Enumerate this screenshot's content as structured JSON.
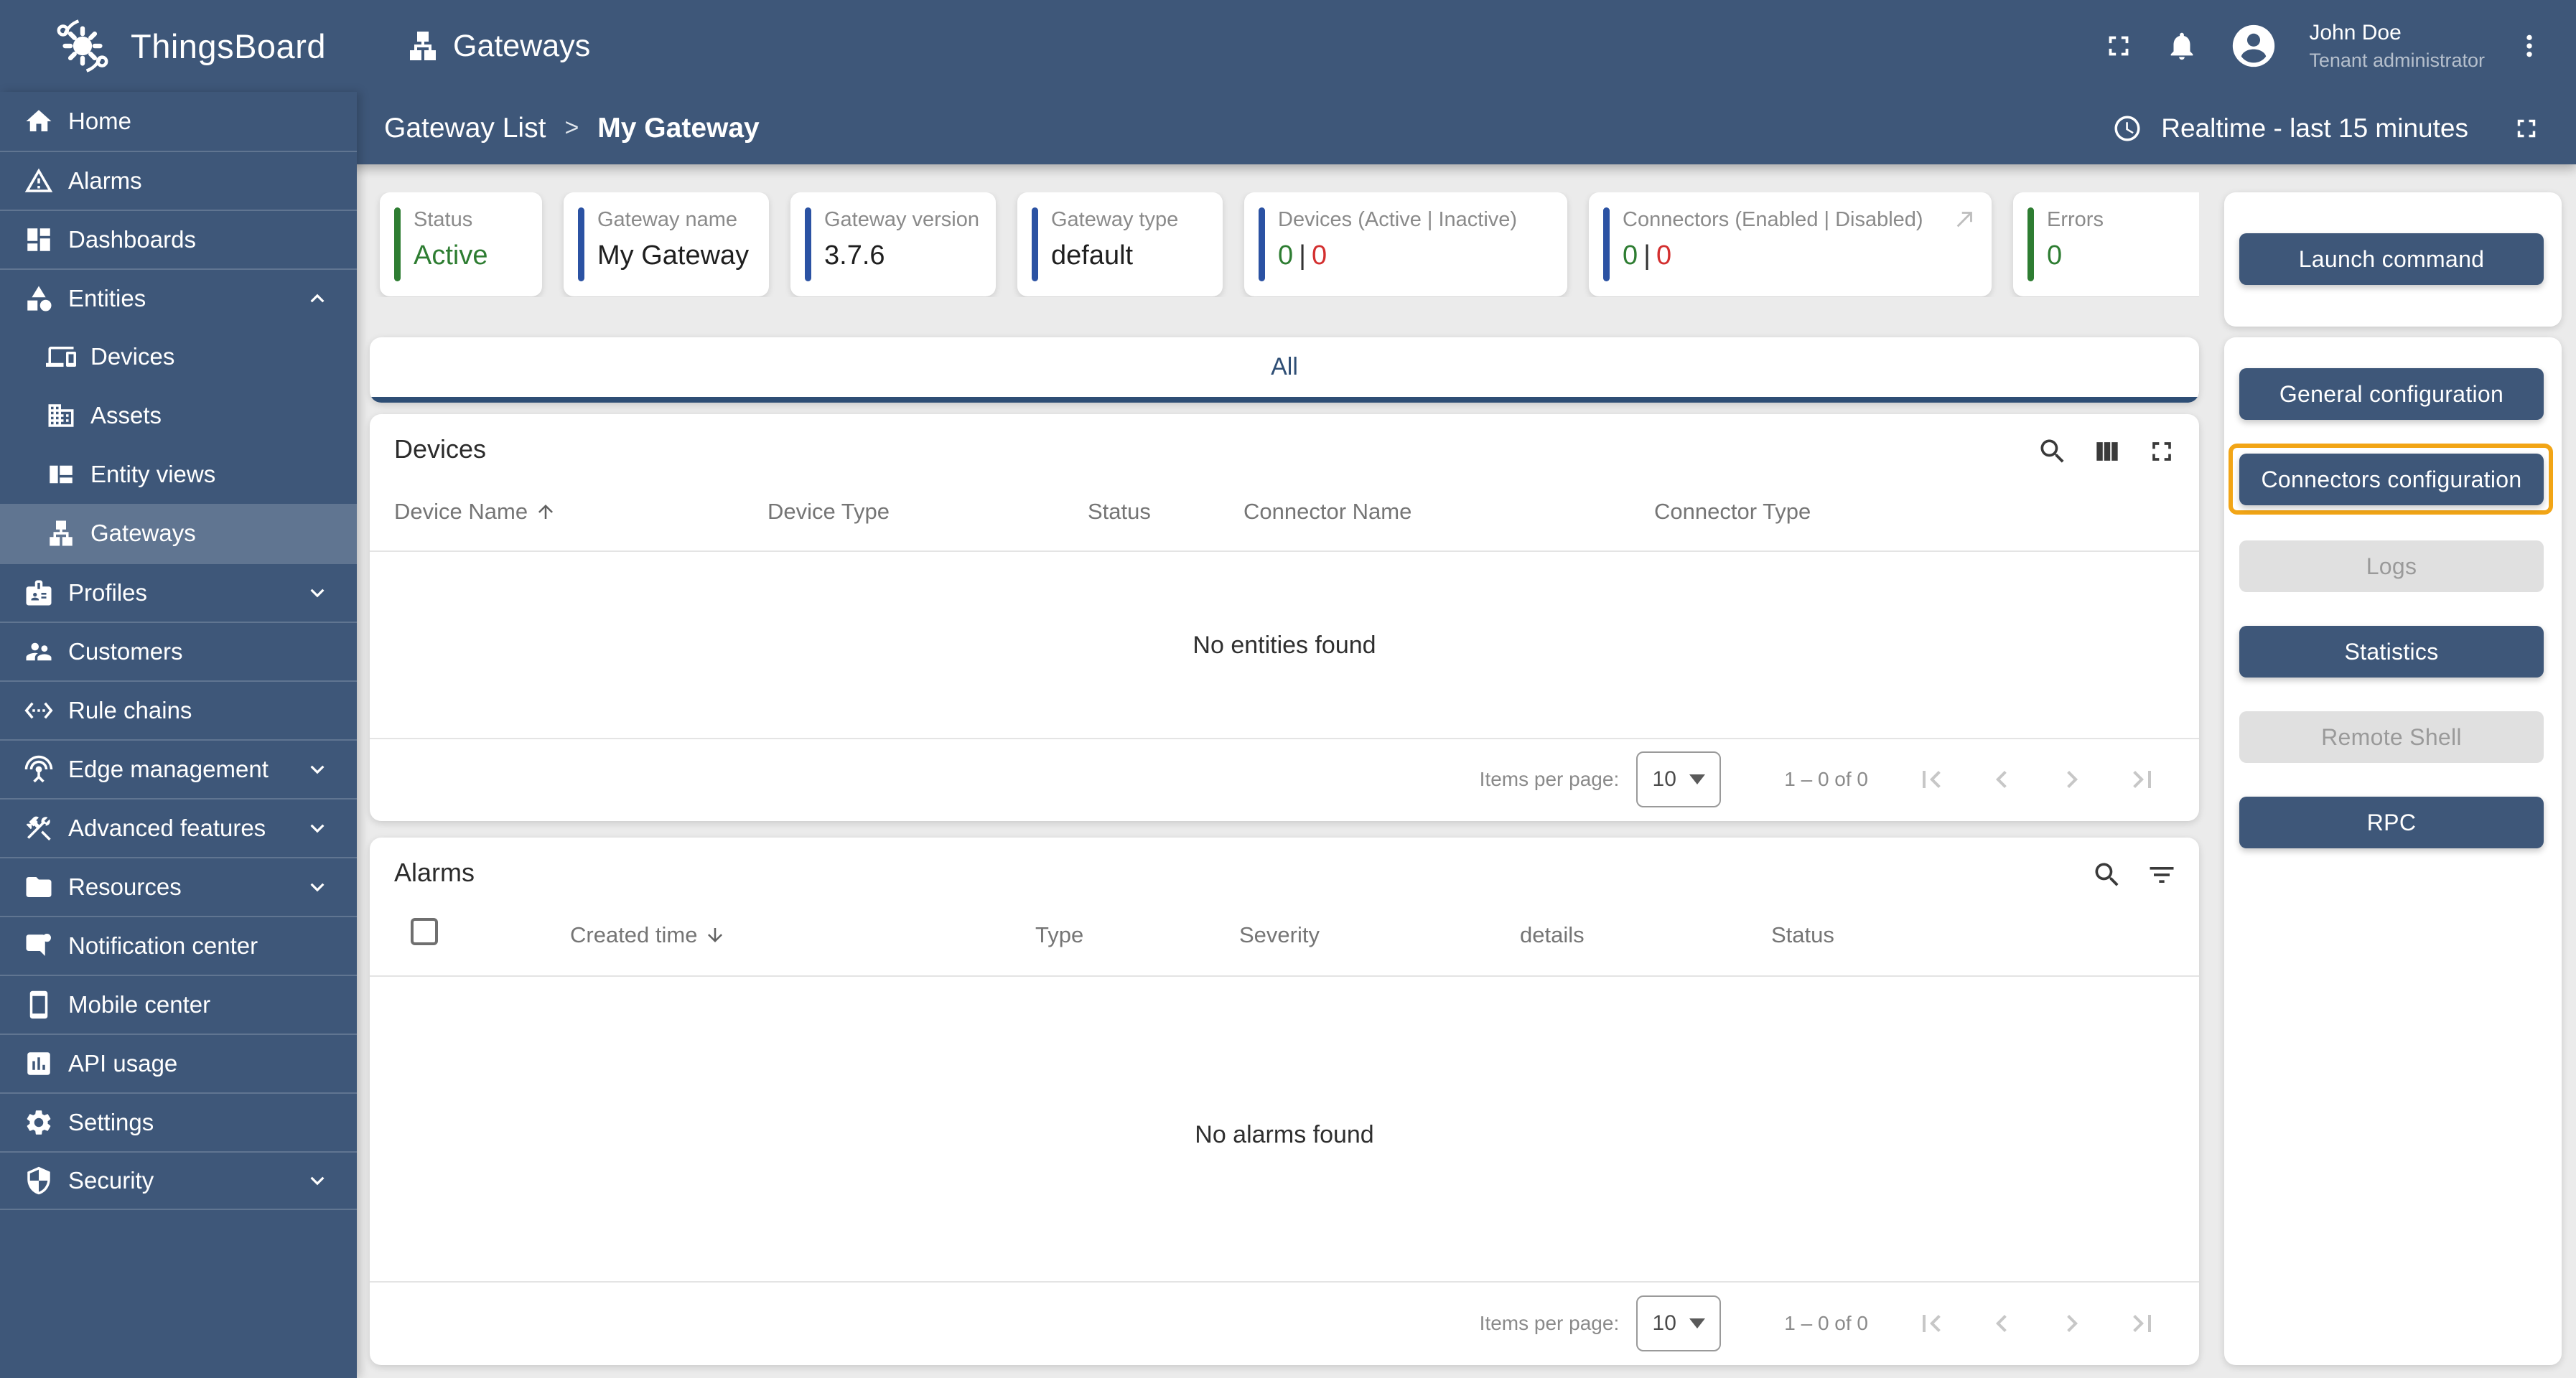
{
  "colors": {
    "primary": "#3E5779",
    "navy": "#2E4E75",
    "green": "#2E7D32",
    "red": "#D32F2F",
    "bar_blue": "#2B52A3",
    "highlight": "#F2A516",
    "disabled_bg": "#E0E0E0"
  },
  "brand": {
    "name": "ThingsBoard"
  },
  "header": {
    "title": "Gateways",
    "user": {
      "name": "John Doe",
      "role": "Tenant administrator"
    }
  },
  "breadcrumb": {
    "parent": "Gateway List",
    "separator": ">",
    "current": "My Gateway"
  },
  "timewindow": {
    "label": "Realtime - last 15 minutes"
  },
  "sidebar": {
    "items": [
      {
        "label": "Home",
        "icon": "home-icon"
      },
      {
        "label": "Alarms",
        "icon": "warning-icon"
      },
      {
        "label": "Dashboards",
        "icon": "dashboard-icon"
      },
      {
        "label": "Entities",
        "icon": "shapes-icon",
        "expanded": true
      },
      {
        "label": "Devices",
        "icon": "devices-icon"
      },
      {
        "label": "Assets",
        "icon": "building-icon"
      },
      {
        "label": "Entity views",
        "icon": "quilt-icon"
      },
      {
        "label": "Gateways",
        "icon": "lan-icon",
        "selected": true
      },
      {
        "label": "Profiles",
        "icon": "badge-icon",
        "expandable": true
      },
      {
        "label": "Customers",
        "icon": "people-icon"
      },
      {
        "label": "Rule chains",
        "icon": "ethernet-icon"
      },
      {
        "label": "Edge management",
        "icon": "antenna-icon",
        "expandable": true
      },
      {
        "label": "Advanced features",
        "icon": "tools-icon",
        "expandable": true
      },
      {
        "label": "Resources",
        "icon": "folder-icon",
        "expandable": true
      },
      {
        "label": "Notification center",
        "icon": "message-icon"
      },
      {
        "label": "Mobile center",
        "icon": "smartphone-icon"
      },
      {
        "label": "API usage",
        "icon": "chart-card-icon"
      },
      {
        "label": "Settings",
        "icon": "gear-icon"
      },
      {
        "label": "Security",
        "icon": "shield-icon",
        "expandable": true
      }
    ]
  },
  "cards": [
    {
      "label": "Status",
      "value": "Active"
    },
    {
      "label": "Gateway name",
      "value": "My Gateway"
    },
    {
      "label": "Gateway version",
      "value": "3.7.6"
    },
    {
      "label": "Gateway type",
      "value": "default"
    },
    {
      "label": "Devices (Active | Inactive)",
      "va": "0",
      "sep": "|",
      "vb": "0"
    },
    {
      "label": "Connectors (Enabled | Disabled)",
      "va": "0",
      "sep": "|",
      "vb": "0"
    },
    {
      "label": "Errors",
      "value": "0"
    }
  ],
  "tabs": {
    "all": "All"
  },
  "devices": {
    "title": "Devices",
    "columns": [
      "Device Name",
      "Device Type",
      "Status",
      "Connector Name",
      "Connector Type"
    ],
    "empty": "No entities found",
    "pagination": {
      "label": "Items per page:",
      "size": "10",
      "range": "1 – 0 of 0"
    }
  },
  "alarms": {
    "title": "Alarms",
    "columns": [
      "Created time",
      "Type",
      "Severity",
      "details",
      "Status"
    ],
    "empty": "No alarms found",
    "pagination": {
      "label": "Items per page:",
      "size": "10",
      "range": "1 – 0 of 0"
    }
  },
  "actions": {
    "launch": "Launch command",
    "buttons": [
      {
        "label": "General configuration",
        "state": "enabled"
      },
      {
        "label": "Connectors configuration",
        "state": "enabled",
        "highlighted": true
      },
      {
        "label": "Logs",
        "state": "disabled"
      },
      {
        "label": "Statistics",
        "state": "enabled"
      },
      {
        "label": "Remote Shell",
        "state": "disabled"
      },
      {
        "label": "RPC",
        "state": "enabled"
      }
    ]
  }
}
